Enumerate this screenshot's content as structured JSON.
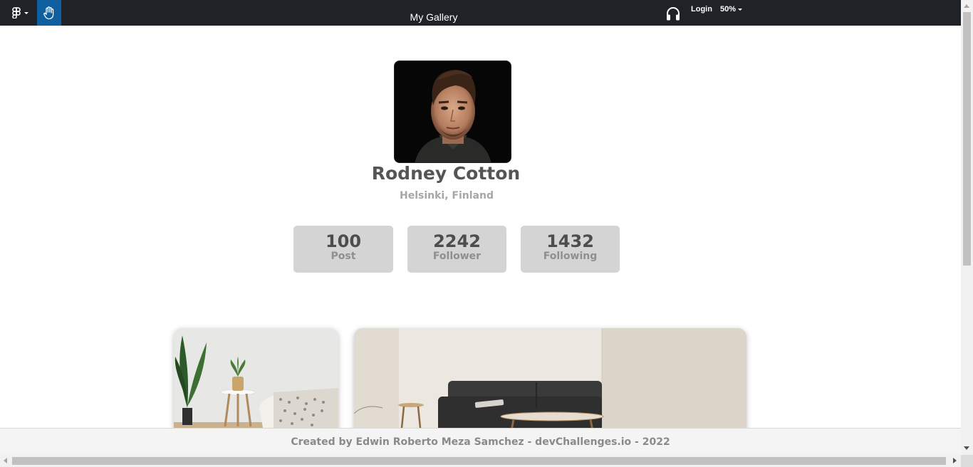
{
  "toolbar": {
    "title": "My Gallery",
    "login_label": "Login",
    "zoom_label": "50%"
  },
  "profile": {
    "name": "Rodney Cotton",
    "location": "Helsinki, Finland"
  },
  "stats": [
    {
      "value": "100",
      "label": "Post"
    },
    {
      "value": "2242",
      "label": "Follower"
    },
    {
      "value": "1432",
      "label": "Following"
    }
  ],
  "footer": {
    "text": "Created by Edwin Roberto Meza Samchez - devChallenges.io - 2022"
  },
  "colors": {
    "topbar": "#1f2328",
    "accent": "#0d5fa0",
    "stat_bg": "#d4d4d4"
  }
}
